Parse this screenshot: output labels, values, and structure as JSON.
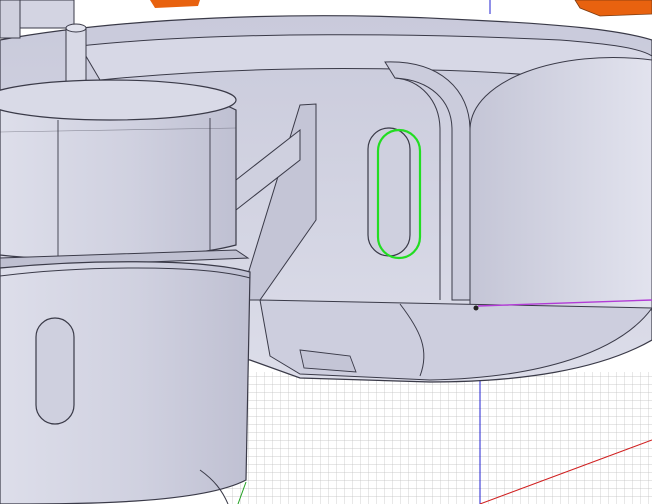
{
  "viewport": {
    "view": "perspective",
    "background_color": "#ffffff",
    "grid_visible": true,
    "grid_color": "#bcbcbc",
    "axis_colors": {
      "x": "#d02020",
      "y": "#20a020",
      "z": "#2020d0"
    }
  },
  "model": {
    "body_color": "#d2d3e3",
    "edge_color": "#3a3a48",
    "accent_color": "#e8620f"
  },
  "selection": {
    "item": "slot-face",
    "highlight_color": "#22dd22",
    "secondary_edge_color": "#b23bd6"
  }
}
